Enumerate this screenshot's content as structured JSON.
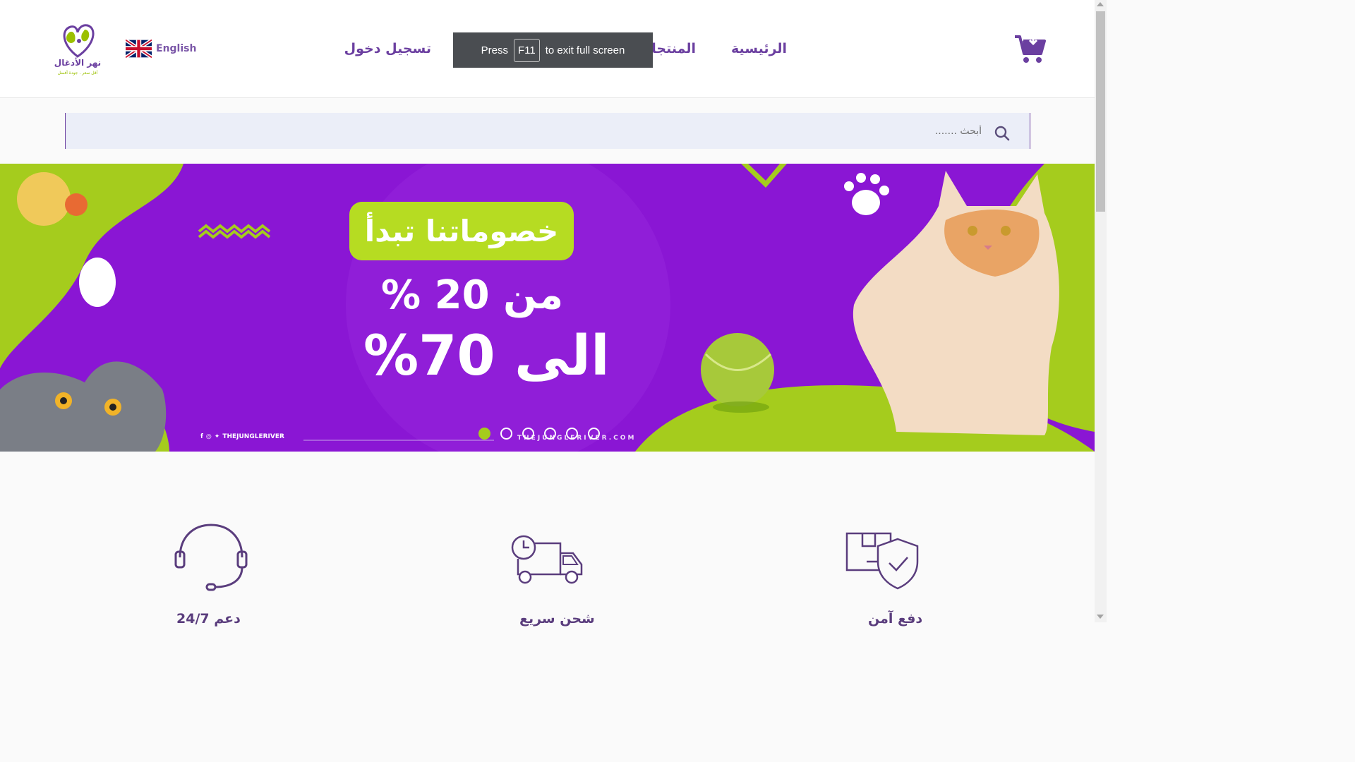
{
  "header": {
    "nav": {
      "home": "الرئيسية",
      "products": "المنتجات",
      "login": "تسجيل دخول"
    },
    "language": "English",
    "logo_text": "نهر الأدغال",
    "logo_tagline": "أقل سعر . جودة أفضل"
  },
  "fullscreen_toast": {
    "press": "Press",
    "key": "F11",
    "rest": "to exit full screen"
  },
  "search": {
    "placeholder": "أبحث ......."
  },
  "banner": {
    "headline": "خصوماتنا تبدأ",
    "line2": "من 20 %",
    "line3": "الى 70%",
    "social_handle": "THEJUNGLERIVER",
    "site_url": "THEJUNGLERIVER.COM",
    "slides_total": 6,
    "active_slide": 1
  },
  "features": [
    {
      "icon": "headset-icon",
      "label": "24/7 دعم"
    },
    {
      "icon": "delivery-truck-icon",
      "label": "شحن سريع"
    },
    {
      "icon": "secure-package-icon",
      "label": "دفع آمن"
    }
  ],
  "colors": {
    "brand_purple": "#6b3fa0",
    "banner_purple": "#8a16d4",
    "accent_green": "#b6dc22"
  }
}
